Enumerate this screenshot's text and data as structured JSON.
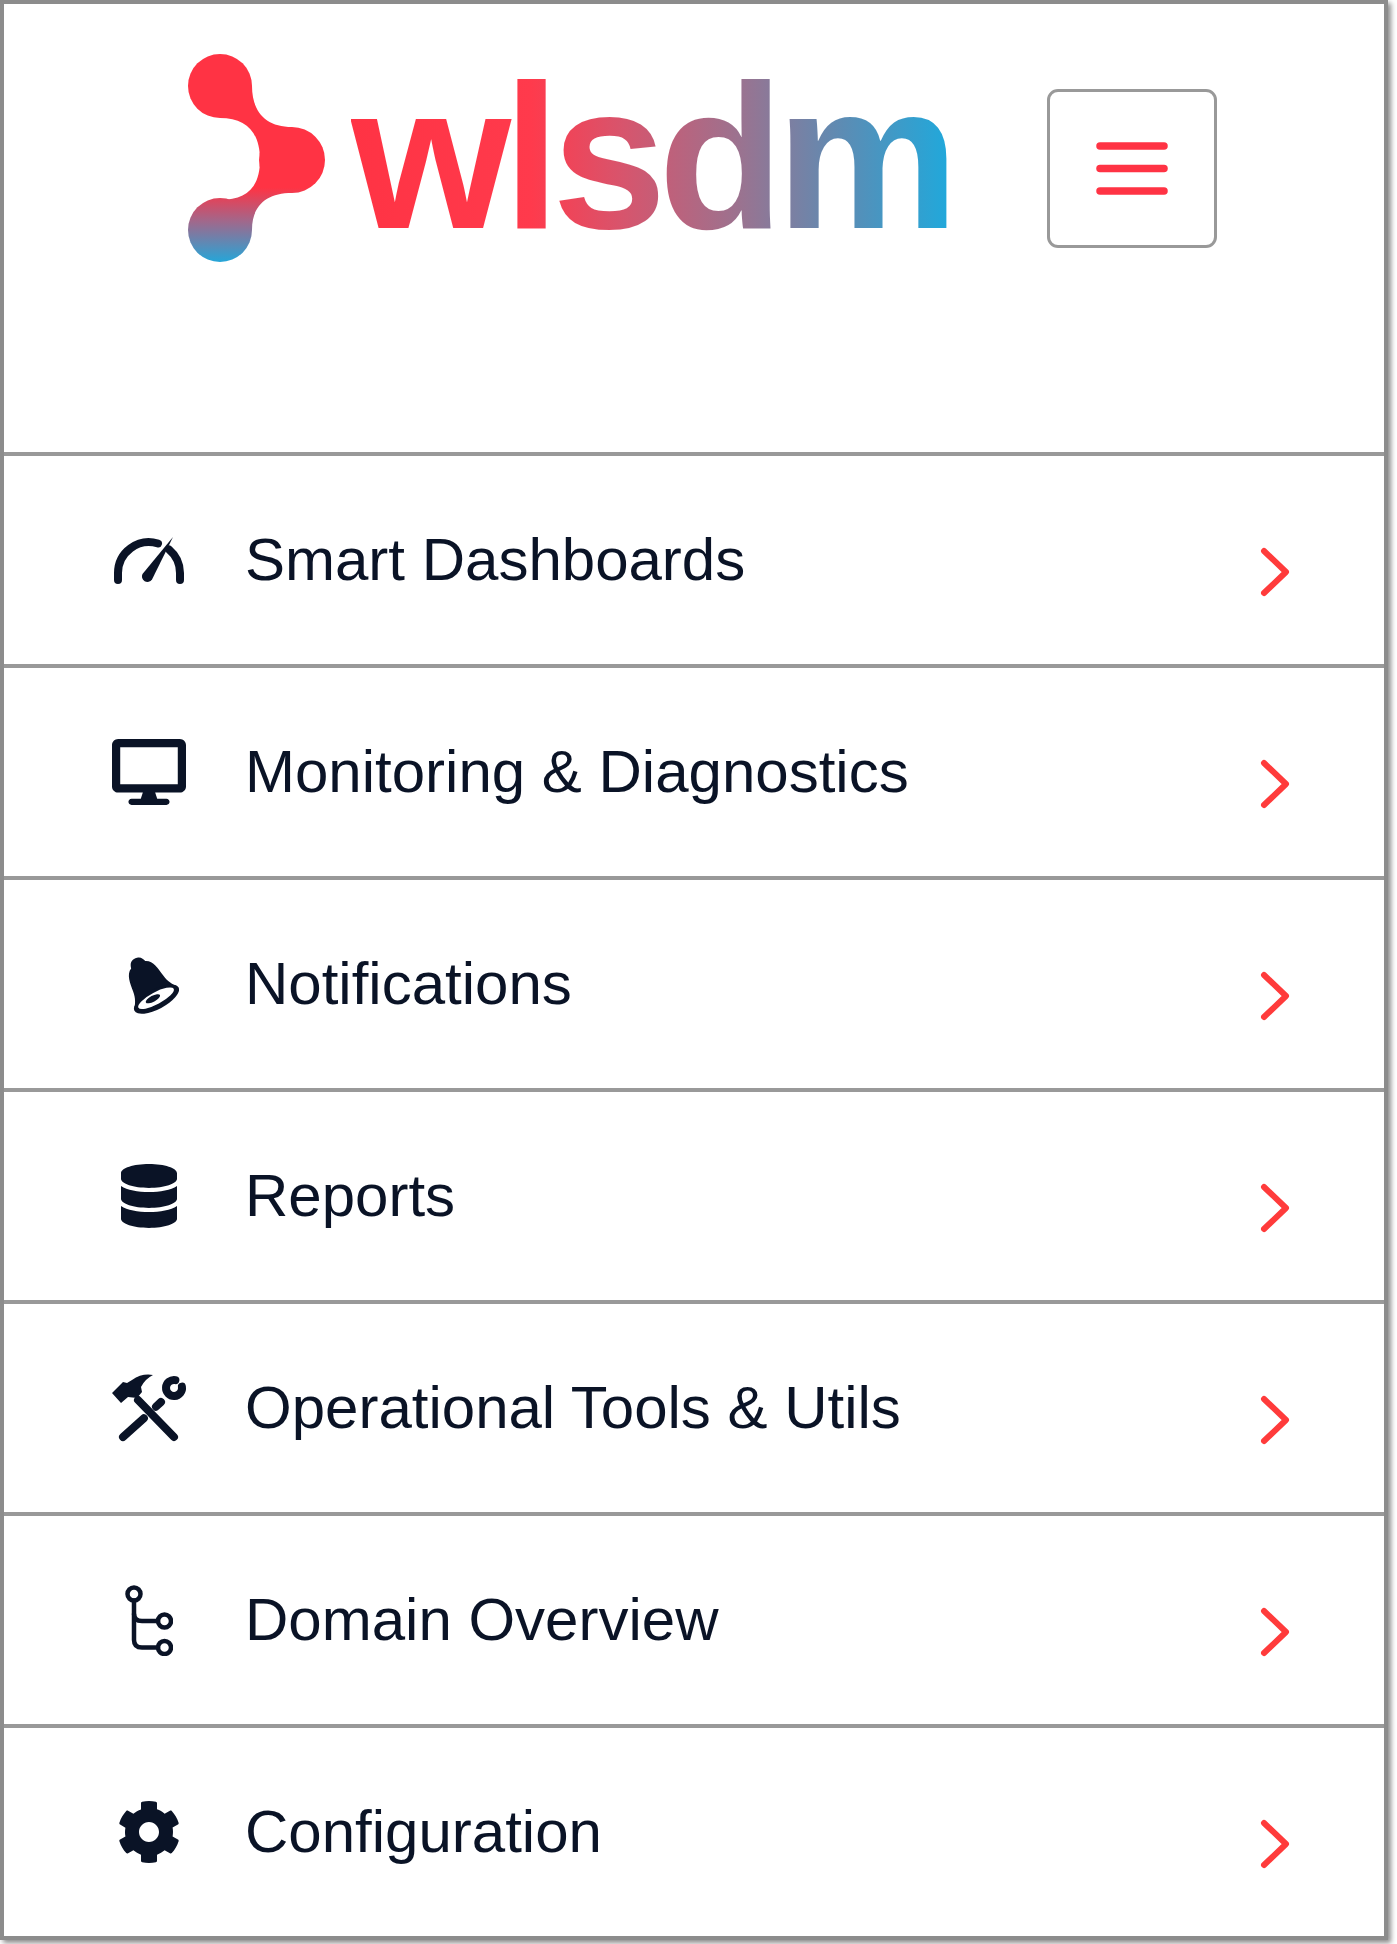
{
  "header": {
    "logo_text": "wlsdm"
  },
  "menu": {
    "items": [
      {
        "label": "Smart Dashboards"
      },
      {
        "label": "Monitoring & Diagnostics"
      },
      {
        "label": "Notifications"
      },
      {
        "label": "Reports"
      },
      {
        "label": "Operational Tools & Utils"
      },
      {
        "label": "Domain Overview"
      },
      {
        "label": "Configuration"
      }
    ]
  }
}
